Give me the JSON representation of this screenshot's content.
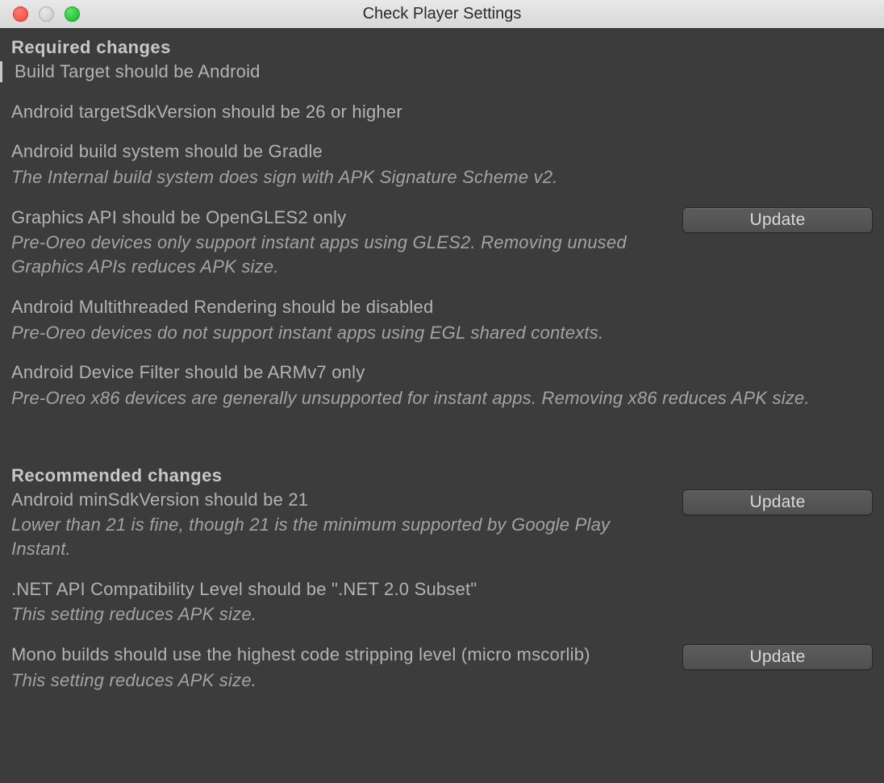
{
  "window": {
    "title": "Check Player Settings"
  },
  "sections": {
    "required": {
      "title": "Required changes",
      "items": [
        {
          "title": "Build Target should be Android",
          "desc": null,
          "button": null
        },
        {
          "title": "Android targetSdkVersion should be 26 or higher",
          "desc": null,
          "button": null
        },
        {
          "title": "Android build system should be Gradle",
          "desc": "The Internal build system does sign with APK Signature Scheme v2.",
          "button": null
        },
        {
          "title": "Graphics API should be OpenGLES2 only",
          "desc": "Pre-Oreo devices only support instant apps using GLES2. Removing unused Graphics APIs reduces APK size.",
          "button": "Update"
        },
        {
          "title": "Android Multithreaded Rendering should be disabled",
          "desc": "Pre-Oreo devices do not support instant apps using EGL shared contexts.",
          "button": null
        },
        {
          "title": "Android Device Filter should be ARMv7 only",
          "desc": "Pre-Oreo x86 devices are generally unsupported for instant apps. Removing x86 reduces APK size.",
          "button": null
        }
      ]
    },
    "recommended": {
      "title": "Recommended changes",
      "items": [
        {
          "title": "Android minSdkVersion should be 21",
          "desc": "Lower than 21 is fine, though 21 is the minimum supported by Google Play Instant.",
          "button": "Update"
        },
        {
          "title": ".NET API Compatibility Level should be \".NET 2.0 Subset\"",
          "desc": "This setting reduces APK size.",
          "button": null
        },
        {
          "title": "Mono builds should use the highest code stripping level (micro mscorlib)",
          "desc": "This setting reduces APK size.",
          "button": "Update"
        }
      ]
    }
  }
}
